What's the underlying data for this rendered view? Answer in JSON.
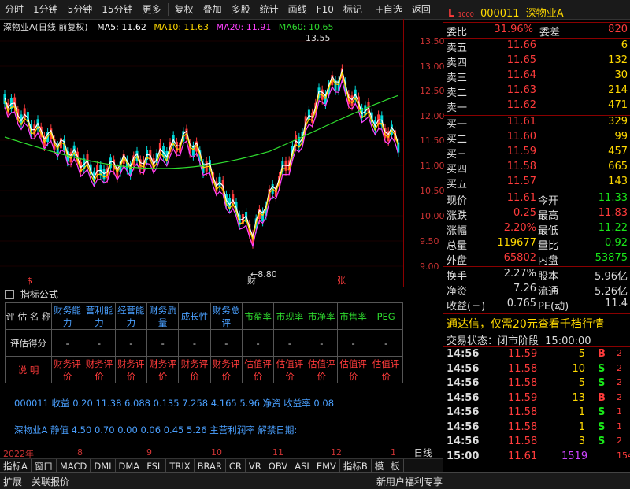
{
  "toolbar": {
    "items": [
      "分时",
      "1分钟",
      "5分钟",
      "15分钟",
      "更多",
      "复权",
      "叠加",
      "多股",
      "统计",
      "画线",
      "F10",
      "标记",
      "+自选",
      "返回"
    ]
  },
  "chart": {
    "title": "深物业A(日线 前复权)",
    "ma": [
      {
        "label": "MA5: 11.62",
        "color": "#ffffff"
      },
      {
        "label": "MA10: 11.63",
        "color": "#ffd900"
      },
      {
        "label": "MA20: 11.91",
        "color": "#ff40ff"
      },
      {
        "label": "MA60: 10.65",
        "color": "#2fdc2f"
      }
    ],
    "y_ticks": [
      "13.50",
      "13.00",
      "12.50",
      "12.00",
      "11.50",
      "11.00",
      "10.50",
      "10.00",
      "9.50",
      "9.00"
    ],
    "high_label": "13.55",
    "low_label": "8.80",
    "markers": [
      "$",
      "财",
      "张"
    ]
  },
  "indicator": {
    "title": "指标公式",
    "row1": [
      "评 估 名 称",
      "财务能力",
      "营利能力",
      "经营能力",
      "财务质量",
      "成长性",
      "财务总评",
      "市盈率",
      "市现率",
      "市净率",
      "市售率",
      "PEG"
    ],
    "row2": [
      "评估得分",
      "-",
      "-",
      "-",
      "-",
      "-",
      "-",
      "-",
      "-",
      "-",
      "-",
      "-"
    ],
    "row3": [
      "说 明",
      "财务评价",
      "财务评价",
      "财务评价",
      "财务评价",
      "财务评价",
      "财务评价",
      "估值评价",
      "估值评价",
      "估值评价",
      "估值评价",
      "估值评价"
    ],
    "fund1": "000011  收益 0.20    11.38    6.088    0.135   7.258    4.165   5.96 净资 收益率 0.08",
    "fund2": "深物业A  静值 4.50    0.70    0.00      0.06     0.45      5.26  主营利润率 解禁日期:"
  },
  "dates": [
    "2022年",
    "8",
    "9",
    "10",
    "11",
    "12",
    "1"
  ],
  "tabs": [
    "指标A",
    "窗口",
    "MACD",
    "DMI",
    "DMA",
    "FSL",
    "TRIX",
    "BRAR",
    "CR",
    "VR",
    "OBV",
    "ASI",
    "EMV",
    "指标B",
    "模",
    "板"
  ],
  "bottom": {
    "left1": "扩展",
    "left2": "关联报价",
    "right": "新用户福利专享"
  },
  "quote": {
    "code": "000011",
    "name": "深物业A",
    "ratio_label": "委比",
    "ratio_value": "31.96%",
    "diff_label": "委差",
    "diff_value": "820",
    "asks": [
      {
        "label": "卖五",
        "price": "11.66",
        "vol": "6"
      },
      {
        "label": "卖四",
        "price": "11.65",
        "vol": "132"
      },
      {
        "label": "卖三",
        "price": "11.64",
        "vol": "30"
      },
      {
        "label": "卖二",
        "price": "11.63",
        "vol": "214"
      },
      {
        "label": "卖一",
        "price": "11.62",
        "vol": "471"
      }
    ],
    "bids": [
      {
        "label": "买一",
        "price": "11.61",
        "vol": "329"
      },
      {
        "label": "买二",
        "price": "11.60",
        "vol": "99"
      },
      {
        "label": "买三",
        "price": "11.59",
        "vol": "457"
      },
      {
        "label": "买四",
        "price": "11.58",
        "vol": "665"
      },
      {
        "label": "买五",
        "price": "11.57",
        "vol": "143"
      }
    ],
    "stats": [
      {
        "l1": "现价",
        "v1": "11.61",
        "c1": "red",
        "l2": "今开",
        "v2": "11.33",
        "c2": "green"
      },
      {
        "l1": "涨跌",
        "v1": "0.25",
        "c1": "red",
        "l2": "最高",
        "v2": "11.83",
        "c2": "red"
      },
      {
        "l1": "涨幅",
        "v1": "2.20%",
        "c1": "red",
        "l2": "最低",
        "v2": "11.22",
        "c2": "green"
      },
      {
        "l1": "总量",
        "v1": "119677",
        "c1": "yellow",
        "l2": "量比",
        "v2": "0.92",
        "c2": "green"
      },
      {
        "l1": "外盘",
        "v1": "65802",
        "c1": "red",
        "l2": "内盘",
        "v2": "53875",
        "c2": "green"
      }
    ],
    "stats2": [
      {
        "l1": "换手",
        "v1": "2.27%",
        "l2": "股本",
        "v2": "5.96亿"
      },
      {
        "l1": "净资",
        "v1": "7.26",
        "l2": "流通",
        "v2": "5.26亿"
      },
      {
        "l1": "收益(三)",
        "v1": "0.765",
        "l2": "PE(动)",
        "v2": "11.4"
      }
    ],
    "ad": "通达信，仅需20元查看千档行情",
    "status_label": "交易状态：闭市阶段",
    "status_time": "15:00:00",
    "trades": [
      {
        "t": "14:56",
        "p": "11.59",
        "v": "5",
        "bs": "B",
        "c": "red",
        "d": "2"
      },
      {
        "t": "14:56",
        "p": "11.58",
        "v": "10",
        "bs": "S",
        "c": "green",
        "d": "2"
      },
      {
        "t": "14:56",
        "p": "11.58",
        "v": "5",
        "bs": "S",
        "c": "green",
        "d": "2"
      },
      {
        "t": "14:56",
        "p": "11.59",
        "v": "13",
        "bs": "B",
        "c": "red",
        "d": "2"
      },
      {
        "t": "14:56",
        "p": "11.58",
        "v": "1",
        "bs": "S",
        "c": "green",
        "d": "1"
      },
      {
        "t": "14:56",
        "p": "11.58",
        "v": "1",
        "bs": "S",
        "c": "green",
        "d": "1"
      },
      {
        "t": "14:56",
        "p": "11.58",
        "v": "3",
        "bs": "S",
        "c": "green",
        "d": "2"
      },
      {
        "t": "15:00",
        "p": "11.61",
        "v": "1519",
        "bs": "",
        "c": "red",
        "d": "154"
      }
    ],
    "rtabs": [
      "笔",
      "价",
      "细",
      "势",
      "联",
      "值",
      "主"
    ]
  }
}
